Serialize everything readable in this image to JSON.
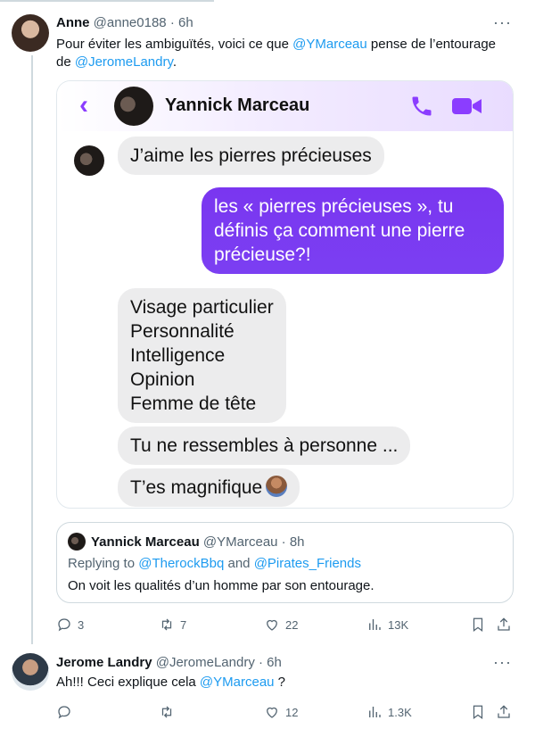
{
  "tweet1": {
    "name": "Anne",
    "handle": "@anne0188",
    "time": "· 6h",
    "more": "···",
    "text_before": "Pour éviter les ambiguïtés, voici ce que ",
    "mention1": "@YMarceau",
    "text_middle": " pense de l’entourage",
    "text_line2_before": "de ",
    "mention2": "@JeromeLandry",
    "text_after": "."
  },
  "screenshot": {
    "contact_name": "Yannick Marceau",
    "messages": {
      "m1": "J’aime les pierres précieuses",
      "m2": [
        "les « pierres précieuses », tu",
        "définis ça comment une pierre",
        "précieuse?!"
      ],
      "m3": [
        "Visage particulier",
        "Personnalité",
        "Intelligence",
        "Opinion",
        "Femme de tête"
      ],
      "m4": "Tu ne ressembles à personne ...",
      "m5": "T’es magnifique"
    },
    "accent": "#7c3aed"
  },
  "quote": {
    "name": "Yannick Marceau",
    "handle": "@YMarceau",
    "time": "· 8h",
    "replying_prefix": "Replying to ",
    "reply_to1": "@TherockBbq",
    "reply_and": " and ",
    "reply_to2": "@Pirates_Friends",
    "text": "On voit les qualités d’un homme par son entourage."
  },
  "actions1": {
    "replies": "3",
    "reposts": "7",
    "likes": "22",
    "views": "13K"
  },
  "tweet2": {
    "name": "Jerome Landry",
    "handle": "@JeromeLandry",
    "time": "· 6h",
    "more": "···",
    "text_before": "Ah!!! Ceci explique cela ",
    "mention": "@YMarceau",
    "text_after": " ?"
  },
  "actions2": {
    "replies": "",
    "reposts": "",
    "likes": "12",
    "views": "1.3K"
  },
  "colors": {
    "link": "#1d9bf0",
    "muted": "#536471",
    "text": "#0f1419"
  }
}
